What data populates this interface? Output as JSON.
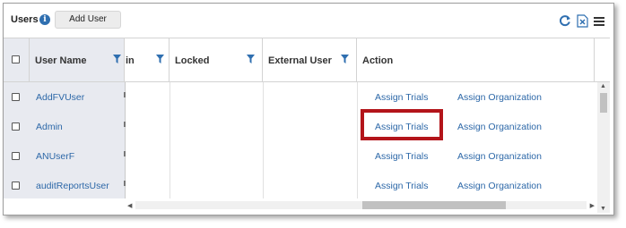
{
  "toolbar": {
    "title": "Users",
    "info_icon": "info-icon",
    "add_user_label": "Add User",
    "icons": [
      "refresh-icon",
      "export-excel-icon",
      "menu-icon"
    ]
  },
  "grid": {
    "columns": [
      {
        "label": "User Name",
        "filter": true
      },
      {
        "label": "in",
        "filter": true
      },
      {
        "label": "Locked",
        "filter": true
      },
      {
        "label": "External User",
        "filter": true
      },
      {
        "label": "Action",
        "filter": false
      }
    ],
    "rows": [
      {
        "username": "AddFVUser",
        "assign": "Assign Trials",
        "org": "Assign Organization"
      },
      {
        "username": "Admin",
        "assign": "Assign Trials",
        "org": "Assign Organization"
      },
      {
        "username": "ANUserF",
        "assign": "Assign Trials",
        "org": "Assign Organization"
      },
      {
        "username": "auditReportsUser",
        "assign": "Assign Trials",
        "org": "Assign Organization"
      }
    ],
    "highlighted_row": 1
  },
  "colors": {
    "link": "#2d68a8",
    "highlight": "#b3141a",
    "frozen_column_bg": "#e8eaf0",
    "info_icon": "#2f6fb0"
  }
}
